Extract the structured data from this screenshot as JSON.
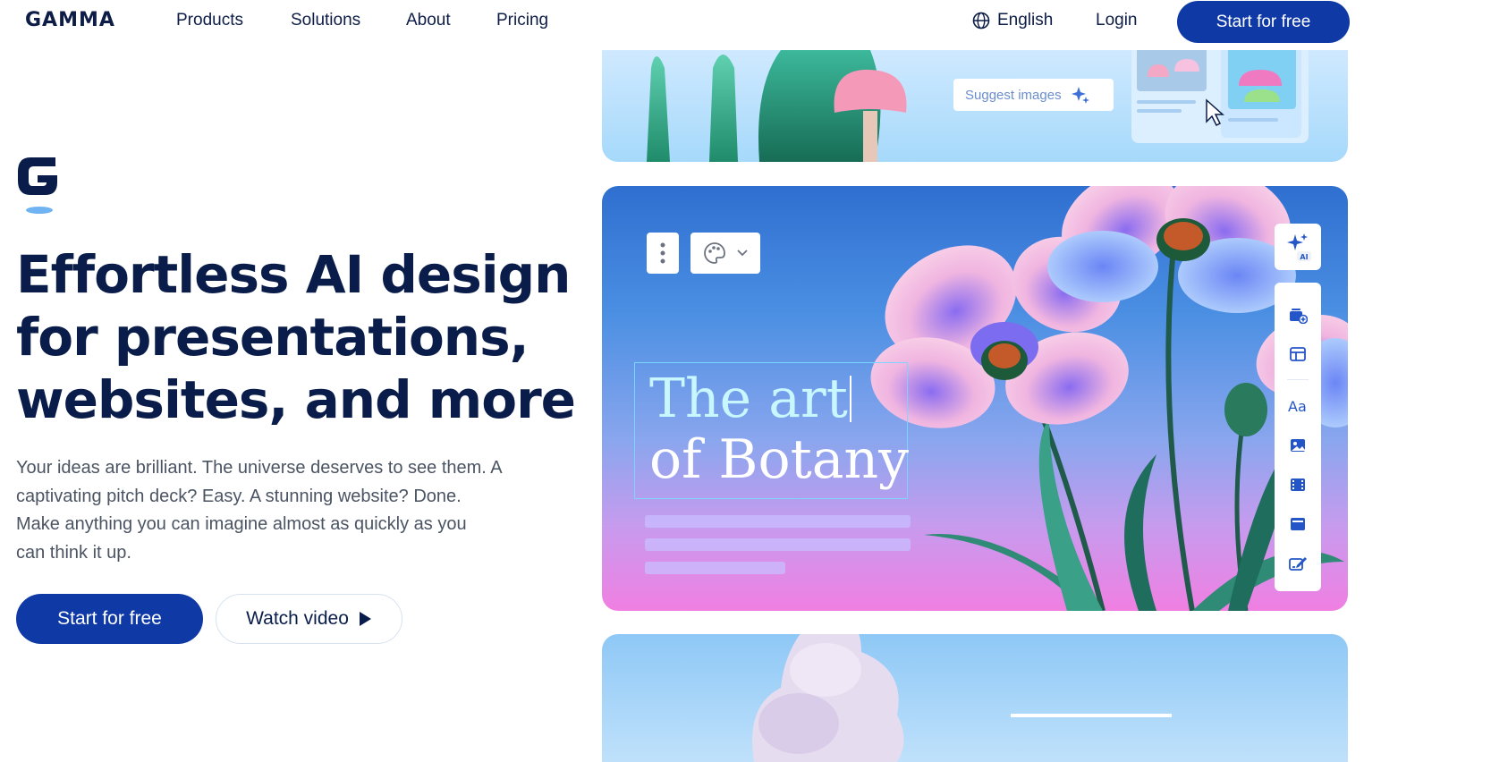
{
  "nav": {
    "logo": "GAMMA",
    "links": [
      "Products",
      "Solutions",
      "About",
      "Pricing"
    ],
    "language": "English",
    "login": "Login",
    "cta": "Start for free"
  },
  "hero": {
    "title_lines": [
      "Effortless AI design",
      "for presentations,",
      "websites, and more"
    ],
    "text_lines": [
      "Your ideas are brilliant. The universe deserves to see them. A",
      "captivating pitch deck? Easy. A stunning website? Done.",
      "Make anything you can imagine almost as quickly as you",
      "can think it up."
    ],
    "primary_button": "Start for free",
    "secondary_button": "Watch video"
  },
  "preview": {
    "suggest_images": "Suggest images",
    "slide_title_line1": "The art",
    "slide_title_line2": "of Botany",
    "ai_badge": "AI",
    "rail_icons": [
      "add-card-icon",
      "layout-icon",
      "text-icon",
      "image-icon",
      "video-icon",
      "embed-icon",
      "edit-icon"
    ]
  },
  "colors": {
    "brand_dark": "#0e1d47",
    "cta_blue": "#0f3aa6",
    "text_gray": "#4b5463"
  }
}
